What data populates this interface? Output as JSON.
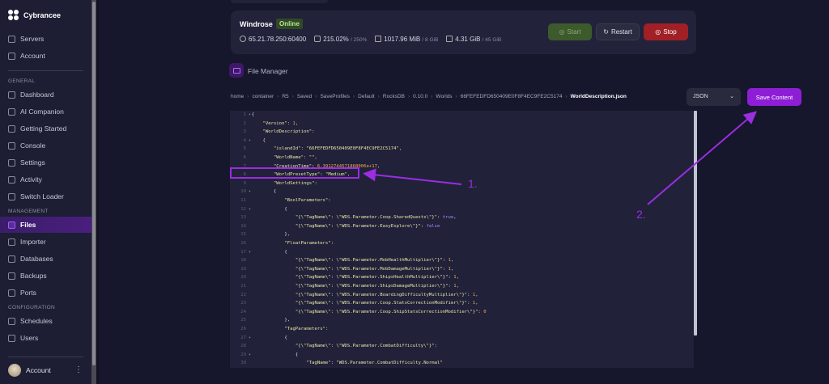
{
  "sidebar": {
    "brand": "Cybrancee",
    "top_items": [
      {
        "label": "Servers",
        "icon": "server-icon"
      },
      {
        "label": "Account",
        "icon": "user-circle-icon"
      }
    ],
    "sections": [
      {
        "title": "GENERAL",
        "items": [
          {
            "label": "Dashboard",
            "icon": "grid-icon"
          },
          {
            "label": "AI Companion",
            "icon": "bot-icon"
          },
          {
            "label": "Getting Started",
            "icon": "globe-icon"
          },
          {
            "label": "Console",
            "icon": "terminal-icon"
          },
          {
            "label": "Settings",
            "icon": "gear-icon"
          },
          {
            "label": "Activity",
            "icon": "eye-icon"
          },
          {
            "label": "Switch Loader",
            "icon": "swap-icon"
          }
        ]
      },
      {
        "title": "MANAGEMENT",
        "items": [
          {
            "label": "Files",
            "icon": "folder-icon",
            "active": true
          },
          {
            "label": "Importer",
            "icon": "download-icon"
          },
          {
            "label": "Databases",
            "icon": "database-icon"
          },
          {
            "label": "Backups",
            "icon": "archive-icon"
          },
          {
            "label": "Ports",
            "icon": "network-icon"
          }
        ]
      },
      {
        "title": "CONFIGURATION",
        "items": [
          {
            "label": "Schedules",
            "icon": "calendar-icon"
          },
          {
            "label": "Users",
            "icon": "users-icon"
          }
        ]
      }
    ],
    "account_label": "Account",
    "more_label": "⋮"
  },
  "server": {
    "name": "Windrose",
    "status": "Online",
    "address": "65.21.78.250:60400",
    "cpu": "215.02%",
    "cpu_limit": "/ 250%",
    "memory": "1017.96 MiB",
    "memory_limit": "/ 8 GiB",
    "disk": "4.31 GiB",
    "disk_limit": "/ 45 GiB",
    "start_label": "Start",
    "restart_label": "Restart",
    "stop_label": "Stop",
    "colors": {
      "start": "#3d5a2c",
      "restart": "#2c2c40",
      "stop": "#a02026"
    }
  },
  "file_manager": {
    "title": "File Manager",
    "breadcrumb": [
      "home",
      "container",
      "R5",
      "Saved",
      "SaveProfiles",
      "Default",
      "RocksDB",
      "0.10.0",
      "Worlds",
      "66FEFEDFD650409E0F8F4EC9FE2C5174",
      "WorldDescription.json"
    ],
    "format": "JSON",
    "save_label": "Save Content"
  },
  "code_lines": [
    [
      [
        "p",
        "{"
      ]
    ],
    [
      [
        "k",
        "    \"Version\""
      ],
      [
        "p",
        ": "
      ],
      [
        "n",
        "1"
      ],
      [
        "p",
        ","
      ]
    ],
    [
      [
        "k",
        "    \"WorldDescription\""
      ],
      [
        "p",
        ":"
      ]
    ],
    [
      [
        "p",
        "    {"
      ]
    ],
    [
      [
        "k",
        "        \"islandId\""
      ],
      [
        "p",
        ": "
      ],
      [
        "s",
        "\"66FEFEDFD650409E0F8F4EC9FE2C5174\""
      ],
      [
        "p",
        ","
      ]
    ],
    [
      [
        "k",
        "        \"WorldName\""
      ],
      [
        "p",
        ": "
      ],
      [
        "s",
        "\"\""
      ],
      [
        "p",
        ","
      ]
    ],
    [
      [
        "k",
        "        \"CreationTime\""
      ],
      [
        "p",
        ": "
      ],
      [
        "n",
        "6.3912744571868006e+17"
      ],
      [
        "p",
        ","
      ]
    ],
    [
      [
        "k",
        "        \"WorldPresetType\""
      ],
      [
        "p",
        ": "
      ],
      [
        "s",
        "\"Medium\""
      ],
      [
        "p",
        ","
      ]
    ],
    [
      [
        "k",
        "        \"WorldSettings\""
      ],
      [
        "p",
        ":"
      ]
    ],
    [
      [
        "p",
        "        {"
      ]
    ],
    [
      [
        "k",
        "            \"BoolParameters\""
      ],
      [
        "p",
        ":"
      ]
    ],
    [
      [
        "p",
        "            {"
      ]
    ],
    [
      [
        "k",
        "                \"{\\\"TagName\\\": \\\"WDS.Parameter.Coop.SharedQuests\\\"}\""
      ],
      [
        "p",
        ": "
      ],
      [
        "b",
        "true"
      ],
      [
        "p",
        ","
      ]
    ],
    [
      [
        "k",
        "                \"{\\\"TagName\\\": \\\"WDS.Parameter.EasyExplore\\\"}\""
      ],
      [
        "p",
        ": "
      ],
      [
        "b",
        "false"
      ]
    ],
    [
      [
        "p",
        "            },"
      ]
    ],
    [
      [
        "k",
        "            \"FloatParameters\""
      ],
      [
        "p",
        ":"
      ]
    ],
    [
      [
        "p",
        "            {"
      ]
    ],
    [
      [
        "k",
        "                \"{\\\"TagName\\\": \\\"WDS.Parameter.MobHealthMultiplier\\\"}\""
      ],
      [
        "p",
        ": "
      ],
      [
        "n",
        "1"
      ],
      [
        "p",
        ","
      ]
    ],
    [
      [
        "k",
        "                \"{\\\"TagName\\\": \\\"WDS.Parameter.MobDamageMultiplier\\\"}\""
      ],
      [
        "p",
        ": "
      ],
      [
        "n",
        "1"
      ],
      [
        "p",
        ","
      ]
    ],
    [
      [
        "k",
        "                \"{\\\"TagName\\\": \\\"WDS.Parameter.ShipsHealthMultiplier\\\"}\""
      ],
      [
        "p",
        ": "
      ],
      [
        "n",
        "1"
      ],
      [
        "p",
        ","
      ]
    ],
    [
      [
        "k",
        "                \"{\\\"TagName\\\": \\\"WDS.Parameter.ShipsDamageMultiplier\\\"}\""
      ],
      [
        "p",
        ": "
      ],
      [
        "n",
        "1"
      ],
      [
        "p",
        ","
      ]
    ],
    [
      [
        "k",
        "                \"{\\\"TagName\\\": \\\"WDS.Parameter.BoardingDifficultyMultiplier\\\"}\""
      ],
      [
        "p",
        ": "
      ],
      [
        "n",
        "1"
      ],
      [
        "p",
        ","
      ]
    ],
    [
      [
        "k",
        "                \"{\\\"TagName\\\": \\\"WDS.Parameter.Coop.StatsCorrectionModifier\\\"}\""
      ],
      [
        "p",
        ": "
      ],
      [
        "n",
        "1"
      ],
      [
        "p",
        ","
      ]
    ],
    [
      [
        "k",
        "                \"{\\\"TagName\\\": \\\"WDS.Parameter.Coop.ShipStatsCorrectionModifier\\\"}\""
      ],
      [
        "p",
        ": "
      ],
      [
        "n",
        "0"
      ]
    ],
    [
      [
        "p",
        "            },"
      ]
    ],
    [
      [
        "k",
        "            \"TagParameters\""
      ],
      [
        "p",
        ":"
      ]
    ],
    [
      [
        "p",
        "            {"
      ]
    ],
    [
      [
        "k",
        "                \"{\\\"TagName\\\": \\\"WDS.Parameter.CombatDifficulty\\\"}\""
      ],
      [
        "p",
        ":"
      ]
    ],
    [
      [
        "p",
        "                {"
      ]
    ],
    [
      [
        "k",
        "                    \"TagName\""
      ],
      [
        "p",
        ": "
      ],
      [
        "s",
        "\"WDS.Parameter.CombatDifficulty.Normal\""
      ]
    ]
  ],
  "fold_lines": [
    1,
    4,
    10,
    12,
    17,
    27,
    29
  ],
  "annotations": {
    "step1": "1.",
    "step2": "2.",
    "color": "#9a2ee0"
  }
}
